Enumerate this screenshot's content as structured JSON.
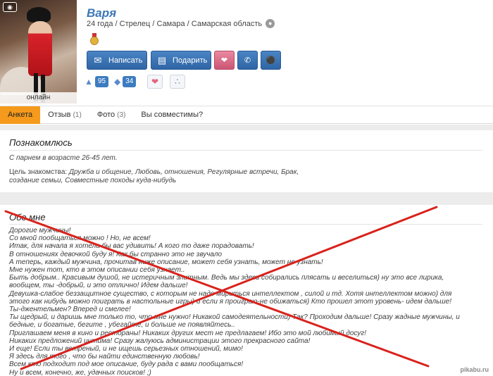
{
  "profile": {
    "name": "Варя",
    "meta": "24 года / Стрелец / Самара / Самарская область",
    "online": "онлайн",
    "camera_icon": "camera-icon"
  },
  "actions": {
    "write": "Написать",
    "gift": "Подарить"
  },
  "stats": {
    "likes": "95",
    "gems": "34"
  },
  "tabs": [
    {
      "label": "Анкета",
      "count": ""
    },
    {
      "label": "Отзыв",
      "count": "(1)"
    },
    {
      "label": "Фото",
      "count": "(3)"
    },
    {
      "label": "Вы совместимы?",
      "count": ""
    }
  ],
  "meet": {
    "title": "Познакомлюсь",
    "age": "С парнем в возрасте 26-45  лет.",
    "goal_label": "Цель знакомства:",
    "goal_line1": "Дружба и общение, Любовь, отношения, Регулярные встречи, Брак,",
    "goal_line2": "создание семьи, Совместные походы куда-нибудь"
  },
  "about": {
    "title": "Обо мне",
    "lines": [
      "Дорогие мужчины!",
      "Со мной пообщаться можно ! Но, не всем!",
      "Итак, для начала я хотела бы вас удивить! А кого то даже порадовать!",
      "В отношениях девочкой буду я! Как бы странно это не звучало",
      "А теперь, каждый мужчина, прочитав ниже описание, может себя узнать, может не узнать!",
      "Мне нужен тот, кто в этом описании себя узнает..",
      "Быть добрым.. Красивым душой, не истеричным элитным. Ведь мы здесь собирались плясать и веселиться) ну это все лирика,",
      "вообщем, ты -добрый, и это отлично! Идем дальше!",
      "Девушка-слабое беззащитное существо, с которым не надо мириться интеллектом , силой и тд. Хотя интеллектом можно) для",
      "этого как нибудь можно поиграть в настольные игры) и если я проиграю-не обижаться) Кто прошел этот уровень- идем дальше!",
      "Ты-джентельмен? Вперед и смелее!",
      "Ты щедрый, и даришь мне только то, что мне нужно! Никакой самодеятельности) Так? Проходим дальше! Сразу жадные мужчины, и",
      "бедные, и богатые, бегите , убегайте, и больше не появляйтесь..",
      "Приглашаем меня в кино и рестораны! Никаких других мест не предлагаем! Ибо это мой любимый досуг!",
      "Никаких предложений интима! Сразу жалуюсь администрации этого прекрасного сайта!",
      "И еще! Если ты ветреный, и не ищешь серьезных отношений, мимо!",
      "Я здесь для того , что бы найти единственную любовь!",
      "Всем кто подходит под мое описание, буду рада с вами пообщаться!",
      "Ну и всем, конечно, же, удачных поисков! ;)"
    ]
  },
  "watermark": "pikabu.ru",
  "colors": {
    "accent_blue": "#3c77b6",
    "tab_active": "#f59a1c",
    "cross_red": "#d9221c"
  }
}
